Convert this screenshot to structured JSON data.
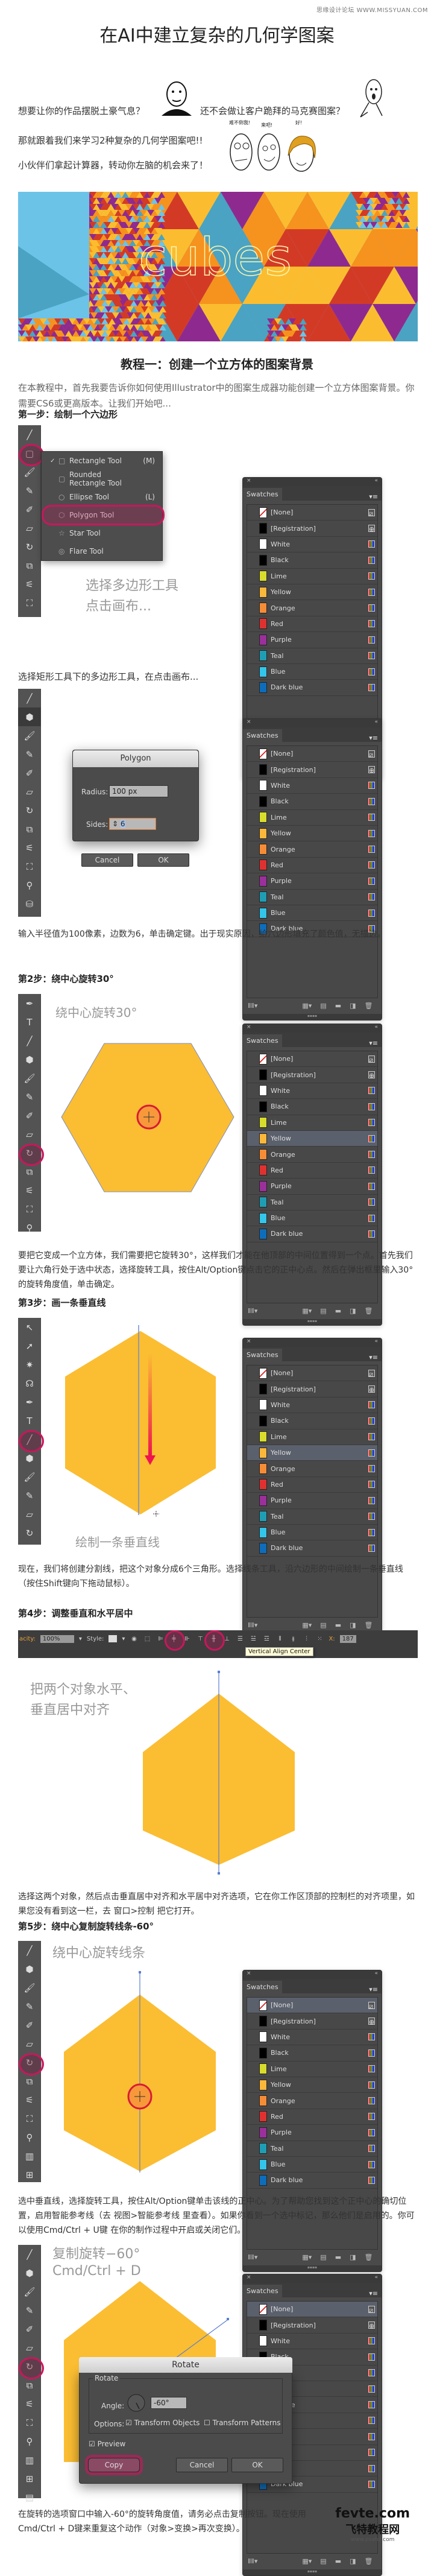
{
  "watermark": "思缘设计论坛 WWW.MISSYUAN.COM",
  "title": "在AI中建立复杂的几何学图案",
  "intro": {
    "line1a": "想要让你的作品摆脱土豪气息？",
    "line1b": "还不会做让客户跪拜的马克赛图案？",
    "line2": "那就跟着我们来学习2种复杂的几何学图案吧!!",
    "line3": "小伙伴们拿起计算器，转动你左脑的机会来了！",
    "meme_bubbles": [
      "难不倒我!",
      "来吧!",
      "好!"
    ]
  },
  "hero": {
    "word": "cubes",
    "colors": [
      "#6cc3e8",
      "#4aa3c2",
      "#fbbd2f",
      "#f6921e",
      "#d33a26",
      "#8e2a8f"
    ]
  },
  "tutorial": {
    "heading": "教程一：创建一个立方体的图案背景",
    "intro": "在本教程中，首先我要告诉你如何使用Illustrator中的图案生成器功能创建一个立方体图案背景。你需要CS6或更高版本。让我们开始吧..."
  },
  "swatches": {
    "panel_title": "Swatches",
    "close": "×",
    "collapse": "«",
    "menu": "▾≡",
    "items": [
      {
        "name": "[None]",
        "color": "#ffffff",
        "type": "none"
      },
      {
        "name": "[Registration]",
        "color": "#000000",
        "type": "reg"
      },
      {
        "name": "White",
        "color": "#ffffff",
        "type": "process"
      },
      {
        "name": "Black",
        "color": "#000000",
        "type": "process"
      },
      {
        "name": "Lime",
        "color": "#d8dc2c",
        "type": "process"
      },
      {
        "name": "Yellow",
        "color": "#fbb73a",
        "type": "process"
      },
      {
        "name": "Orange",
        "color": "#f78c36",
        "type": "process"
      },
      {
        "name": "Red",
        "color": "#e03131",
        "type": "process"
      },
      {
        "name": "Purple",
        "color": "#9b2f9b",
        "type": "process"
      },
      {
        "name": "Teal",
        "color": "#1f9db4",
        "type": "process"
      },
      {
        "name": "Blue",
        "color": "#33c5ea",
        "type": "process"
      },
      {
        "name": "Dark blue",
        "color": "#0d6dbb",
        "type": "process"
      }
    ],
    "footer_icons": [
      "library-icon",
      "swatch-kinds-icon",
      "swatch-options-icon",
      "new-group-icon",
      "new-swatch-icon",
      "delete-icon"
    ]
  },
  "step1": {
    "heading": "第一步：绘制一个六边形",
    "menu": [
      {
        "label": "Rectangle Tool",
        "shortcut": "(M)",
        "checked": true,
        "icon": "□"
      },
      {
        "label": "Rounded Rectangle Tool",
        "shortcut": "",
        "checked": false,
        "icon": "▢"
      },
      {
        "label": "Ellipse Tool",
        "shortcut": "(L)",
        "checked": false,
        "icon": "○"
      },
      {
        "label": "Polygon Tool",
        "shortcut": "",
        "checked": false,
        "icon": "⬡"
      },
      {
        "label": "Star Tool",
        "shortcut": "",
        "checked": false,
        "icon": "☆"
      },
      {
        "label": "Flare Tool",
        "shortcut": "",
        "checked": false,
        "icon": "◎"
      }
    ],
    "callout_line1": "选择多边形工具",
    "callout_line2": "点击画布...",
    "caption": "选择矩形工具下的多边形工具，在点击画布..."
  },
  "polygon_dialog": {
    "title": "Polygon",
    "radius_label": "Radius:",
    "radius_value": "100 px",
    "sides_label": "Sides:",
    "sides_value": "6",
    "cancel": "Cancel",
    "ok": "OK"
  },
  "step1_text": "输入半径值为100像素，边数为6，单击确定键。出于现实原因，给六边形填充了颜色值，无描边。",
  "step2": {
    "heading": "第2步：绕中心旋转30°",
    "callout": "绕中心旋转30°",
    "text": "要把它变成一个立方体，我们需要把它旋转30°，这样我们才能在他顶部的中间位置得到一个点。首先我们要让六角行处于选中状态，选择旋转工具，按住Alt/Option键点击它的正中心点。然后在弹出框里输入30°的旋转角度值，单击确定。"
  },
  "step3": {
    "heading": "第3步：画一条垂直线",
    "callout": "绘制一条垂直线",
    "text": "现在，我们将创建分割线，把这个对象分成6个三角形。选择线条工具，沿六边形的中间绘制一条垂直线（按住Shift键向下拖动鼠标）。"
  },
  "step4": {
    "heading": "第4步：调整垂直和水平居中",
    "control_bar": {
      "opacity_label": "acity:",
      "opacity_value": "100%",
      "style_label": "Style:",
      "x_label": "X:",
      "x_value": "187",
      "tooltip": "Vertical Align Center"
    },
    "callout_line1": "把两个对象水平、",
    "callout_line2": "垂直居中对齐",
    "text": "选择这两个对象，然后点击垂直居中对齐和水平居中对齐选项，它在你工作区顶部的控制栏的对齐项里，如果您没有看到这一栏，去 窗口>控制 把它打开。"
  },
  "step5": {
    "heading": "第5步：绕中心复制旋转线条-60°",
    "callout": "绕中心旋转线条",
    "text": "选中垂直线，选择旋转工具，按住Alt/Option键单击该线的正中心。为了帮助您找到这个正中心的确切位置，启用智能参考线（去 视图>智能参考线 里查看）。如果你看到一个选中标记，那么他们是启用的。你可以使用Cmd/Ctrl + U键 在你的制作过程中开启或关闭它们。"
  },
  "step6": {
    "callout_line1": "复制旋转−60°",
    "callout_line2": "Cmd/Ctrl + D",
    "text": "在旋转的选项窗口中输入-60°的旋转角度值，请务必点击复制按钮。现在使用Cmd/Ctrl + D键来重复这个动作（对象>变换>再次变换）。"
  },
  "rotate_dialog": {
    "title": "Rotate",
    "group": "Rotate",
    "angle_label": "Angle:",
    "angle_value": "-60°",
    "options_label": "Options:",
    "transform_objects": "Transform Objects",
    "transform_objects_checked": true,
    "transform_patterns": "Transform Patterns",
    "transform_patterns_checked": false,
    "preview": "Preview",
    "preview_checked": true,
    "copy": "Copy",
    "cancel": "Cancel",
    "ok": "OK"
  },
  "footer_logo": {
    "line1": "fevte.com",
    "line2": "飞特教程网",
    "line3": "www.psahz.com"
  }
}
